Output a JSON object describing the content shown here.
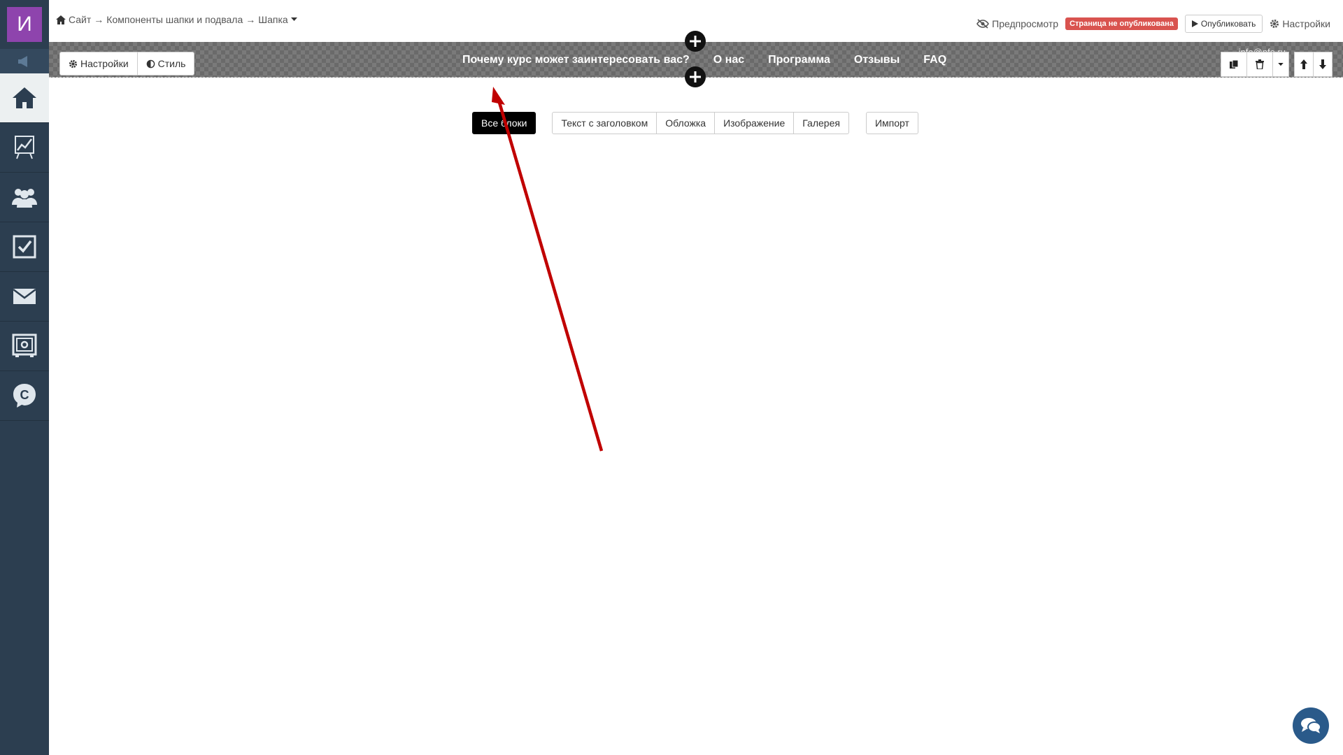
{
  "app": {
    "logo_letter": "И"
  },
  "breadcrumb": {
    "items": [
      "Сайт",
      "Компоненты шапки и подвала",
      "Шапка"
    ],
    "separator": "→"
  },
  "topbar": {
    "preview_label": "Предпросмотр",
    "status_badge": "Страница не опубликована",
    "publish_label": "Опубликовать",
    "settings_label": "Настройки"
  },
  "header_block": {
    "settings_label": "Настройки",
    "style_label": "Стиль",
    "nav": [
      "Почему курс может заинтересовать вас?",
      "О нас",
      "Программа",
      "Отзывы",
      "FAQ"
    ],
    "email_partial": "info@nfo.ru"
  },
  "block_filter": {
    "all": "Все блоки",
    "group": [
      "Текст с заголовком",
      "Обложка",
      "Изображение",
      "Галерея"
    ],
    "import": "Импорт"
  },
  "sidebar": {
    "items": [
      "home-icon",
      "chart-icon",
      "users-icon",
      "tasks-icon",
      "mail-icon",
      "safe-icon",
      "chat-c-icon"
    ]
  },
  "colors": {
    "sidebar": "#2c3e50",
    "logo": "#8e44ad",
    "badge": "#d9534f",
    "arrow": "#c00000",
    "chat": "#2a5a8a"
  }
}
